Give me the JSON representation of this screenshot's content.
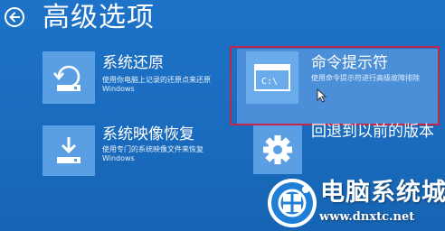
{
  "header": {
    "title": "高级选项"
  },
  "tiles": [
    {
      "title": "系统还原",
      "desc1": "使用你电脑上记录的还原点来还原",
      "desc2": "Windows"
    },
    {
      "title": "命令提示符",
      "desc1": "使用命令提示符进行高级故障排除",
      "desc2": ""
    },
    {
      "title": "系统映像恢复",
      "desc1": "使用专门的系统映像文件来恢复",
      "desc2": "Windows"
    },
    {
      "title": "回退到以前的版本",
      "desc1": "",
      "desc2": ""
    }
  ],
  "cmd_icon_text": "C:\\",
  "watermark": {
    "title": "电脑系统城",
    "url": "www.dnxtc.net"
  },
  "colors": {
    "background": "#1b6fc2",
    "tile_icon": "#5a9fe4",
    "selected_tile": "#4b8fd8",
    "highlight_border": "#c3264a"
  },
  "icons": {
    "back": "arrow-left-circle-icon",
    "system_restore": "restore-drive-icon",
    "command_prompt": "terminal-window-icon",
    "image_recovery": "download-drive-icon",
    "go_back": "gear-icon",
    "cursor": "mouse-pointer-icon",
    "watermark_logo": "windows-logo-icon"
  }
}
